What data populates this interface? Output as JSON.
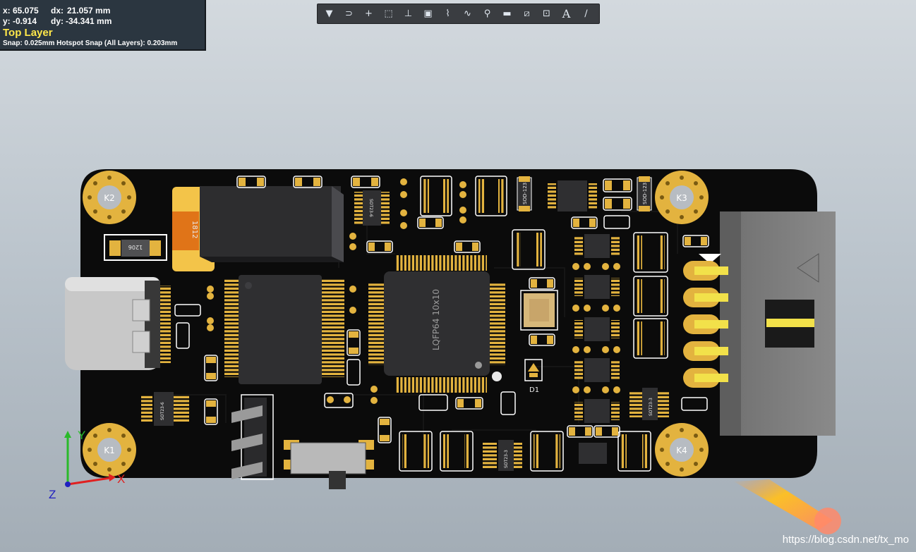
{
  "hud": {
    "x_label": "x:",
    "x_value": "65.075",
    "dx_label": "dx:",
    "dx_value": "21.057 mm",
    "y_label": "y:",
    "y_value": "-0.914",
    "dy_label": "dy:",
    "dy_value": "-34.341 mm",
    "layer": "Top Layer",
    "snap": "Snap: 0.025mm Hotspot Snap (All Layers): 0.203mm"
  },
  "toolbar": {
    "tools": [
      "filter-icon",
      "interactive-route-icon",
      "cross-probe-icon",
      "select-rect-icon",
      "align-icon",
      "component-icon",
      "route-icon",
      "diff-pair-icon",
      "via-icon",
      "fill-icon",
      "region-icon",
      "dimension-icon",
      "string-icon",
      "line-icon"
    ]
  },
  "board": {
    "mount_holes": [
      "K1",
      "K2",
      "K3",
      "K4"
    ],
    "labels": {
      "mcu": "LQFP64 10x10",
      "cap_1812": "1812",
      "cap_1206": "1206",
      "diode": "D1",
      "sod_a": "SOD-123",
      "sod_b": "SOD-123",
      "sot_a": "SOT23-6",
      "sot_b": "SOT23-6",
      "sot_c": "SOT23-3",
      "sot_d": "SOT23-3"
    },
    "colors": {
      "solder_mask": "#0b0b0b",
      "copper": "#e3b33f",
      "silk": "#e8e8e8"
    }
  },
  "axes": {
    "x": "X",
    "y": "Y",
    "z": "Z"
  },
  "watermark": "https://blog.csdn.net/tx_mo"
}
